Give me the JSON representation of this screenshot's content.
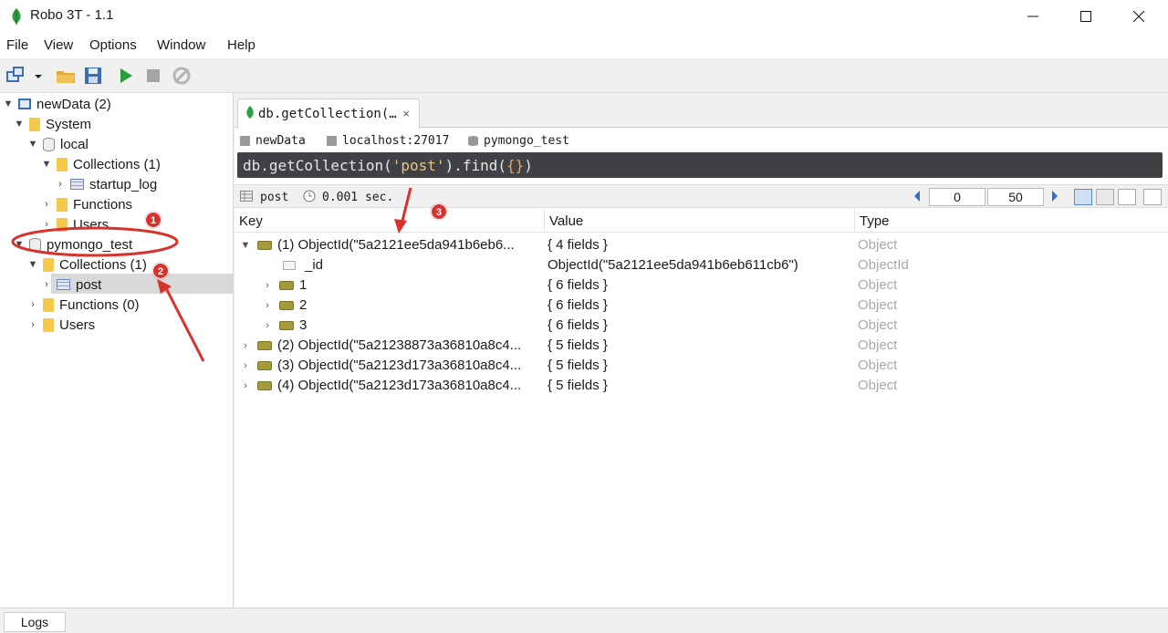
{
  "window": {
    "title": "Robo 3T - 1.1"
  },
  "menu": [
    "File",
    "View",
    "Options",
    "Window",
    "Help"
  ],
  "tree": {
    "root": "newData (2)",
    "system": "System",
    "local": "local",
    "local_collections": "Collections (1)",
    "startup_log": "startup_log",
    "local_functions": "Functions",
    "local_users": "Users",
    "pymongo": "pymongo_test",
    "py_collections": "Collections (1)",
    "post": "post",
    "py_functions": "Functions (0)",
    "py_users": "Users"
  },
  "tab": {
    "label": "db.getCollection(…",
    "close": "×"
  },
  "crumbs": {
    "server": "newData",
    "host": "localhost:27017",
    "db": "pymongo_test"
  },
  "query": {
    "prefix": "db.getCollection(",
    "arg": "'post'",
    "mid": ").find(",
    "obj": "{}",
    "suffix": ")"
  },
  "result": {
    "collection": "post",
    "time": "0.001 sec.",
    "skip": "0",
    "limit": "50"
  },
  "columns": {
    "key": "Key",
    "value": "Value",
    "type": "Type"
  },
  "rows": [
    {
      "key": "(1) ObjectId(\"5a2121ee5da941b6eb6...",
      "value": "{ 4 fields }",
      "type": "Object"
    },
    {
      "key": "_id",
      "value": "ObjectId(\"5a2121ee5da941b6eb611cb6\")",
      "type": "ObjectId"
    },
    {
      "key": "1",
      "value": "{ 6 fields }",
      "type": "Object"
    },
    {
      "key": "2",
      "value": "{ 6 fields }",
      "type": "Object"
    },
    {
      "key": "3",
      "value": "{ 6 fields }",
      "type": "Object"
    },
    {
      "key": "(2) ObjectId(\"5a21238873a36810a8c4...",
      "value": "{ 5 fields }",
      "type": "Object"
    },
    {
      "key": "(3) ObjectId(\"5a2123d173a36810a8c4...",
      "value": "{ 5 fields }",
      "type": "Object"
    },
    {
      "key": "(4) ObjectId(\"5a2123d173a36810a8c4...",
      "value": "{ 5 fields }",
      "type": "Object"
    }
  ],
  "annotations": [
    "1",
    "2",
    "3"
  ],
  "bottom": {
    "logs": "Logs"
  },
  "colors": {
    "accent": "#2e9e3e",
    "annotation": "#d7322c",
    "query_bg": "#3f4144"
  }
}
